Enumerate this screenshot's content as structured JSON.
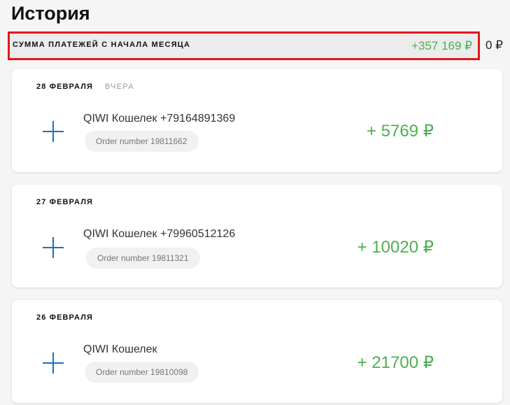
{
  "page": {
    "title": "История"
  },
  "summary": {
    "label": "СУММА ПЛАТЕЖЕЙ С НАЧАЛА МЕСЯЦА",
    "income": "+357 169 ₽",
    "outcome": "0 ₽"
  },
  "colors": {
    "income": "#4caf50",
    "highlight_border": "#e3171b",
    "plus_icon": "#1c6fc2"
  },
  "groups": [
    {
      "date": "28 ФЕВРАЛЯ",
      "when": "ВЧЕРА",
      "items": [
        {
          "icon": "plus-icon",
          "provider": "QIWI Кошелек +79164891369",
          "order": "Order number 19811662",
          "amount": "+ 5769 ₽"
        }
      ]
    },
    {
      "date": "27 ФЕВРАЛЯ",
      "when": "",
      "items": [
        {
          "icon": "plus-icon",
          "provider": "QIWI Кошелек +79960512126",
          "order": "Order number 19811321",
          "amount": "+ 10020 ₽"
        }
      ]
    },
    {
      "date": "26 ФЕВРАЛЯ",
      "when": "",
      "items": [
        {
          "icon": "plus-icon",
          "provider": "QIWI Кошелек",
          "order": "Order number 19810098",
          "amount": "+ 21700 ₽"
        }
      ]
    }
  ]
}
